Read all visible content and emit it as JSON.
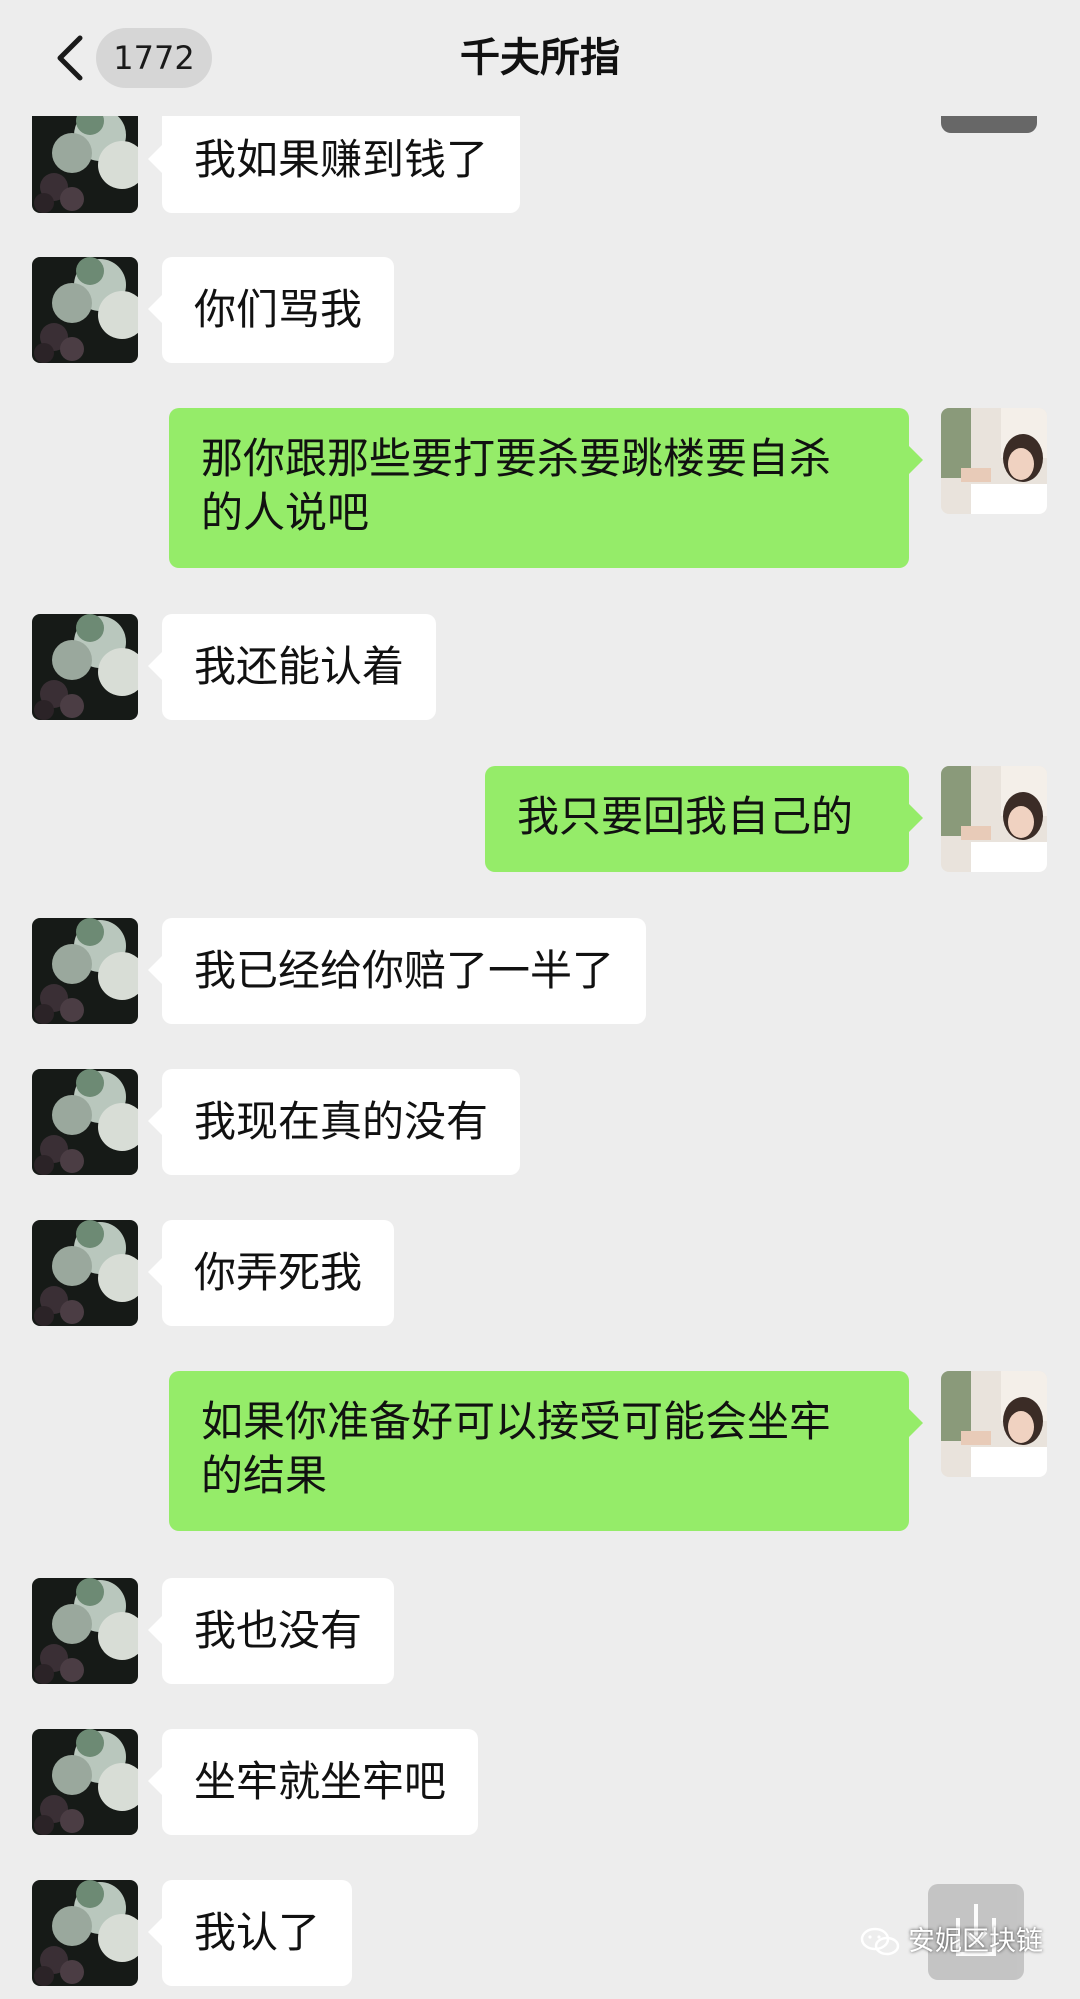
{
  "header": {
    "back_icon": "chevron-left-icon",
    "unread_count": "1772",
    "title": "千夫所指",
    "more_icon": "more-icon"
  },
  "messages": [
    {
      "direction": "incoming",
      "text": "我如果赚到钱了"
    },
    {
      "direction": "incoming",
      "text": "你们骂我"
    },
    {
      "direction": "outgoing",
      "text": "那你跟那些要打要杀要跳楼要自杀\n的人说吧"
    },
    {
      "direction": "incoming",
      "text": "我还能认着"
    },
    {
      "direction": "outgoing",
      "text": "我只要回我自己的"
    },
    {
      "direction": "incoming",
      "text": "我已经给你赔了一半了"
    },
    {
      "direction": "incoming",
      "text": "我现在真的没有"
    },
    {
      "direction": "incoming",
      "text": "你弄死我"
    },
    {
      "direction": "outgoing",
      "text": "如果你准备好可以接受可能会坐牢\n的结果"
    },
    {
      "direction": "incoming",
      "text": "我也没有"
    },
    {
      "direction": "incoming",
      "text": "坐牢就坐牢吧"
    },
    {
      "direction": "incoming",
      "text": "我认了"
    }
  ],
  "scroll_button_icon": "scroll-down-icon",
  "watermark": {
    "icon": "wechat-icon",
    "text": "安妮区块链"
  },
  "colors": {
    "background": "#ededed",
    "incoming_bubble": "#ffffff",
    "outgoing_bubble": "#95ec69",
    "badge": "#d6d6d6",
    "more_button": "#676767"
  }
}
